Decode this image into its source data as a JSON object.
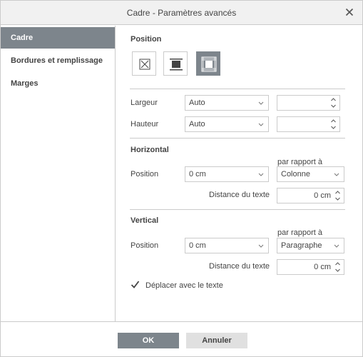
{
  "dialog": {
    "title": "Cadre - Paramètres avancés",
    "close_icon": "close-icon"
  },
  "sidebar": {
    "items": [
      {
        "label": "Cadre",
        "active": true
      },
      {
        "label": "Bordures et remplissage",
        "active": false
      },
      {
        "label": "Marges",
        "active": false
      }
    ]
  },
  "position": {
    "heading": "Position",
    "options": [
      "none-icon",
      "inline-icon",
      "frame-icon"
    ],
    "selected": 2
  },
  "size": {
    "width_label": "Largeur",
    "width_mode": "Auto",
    "width_value": "",
    "height_label": "Hauteur",
    "height_mode": "Auto",
    "height_value": ""
  },
  "horizontal": {
    "heading": "Horizontal",
    "position_label": "Position",
    "position_value": "0 cm",
    "relative_label": "par rapport à",
    "relative_value": "Colonne",
    "distance_label": "Distance du texte",
    "distance_value": "0 cm"
  },
  "vertical": {
    "heading": "Vertical",
    "position_label": "Position",
    "position_value": "0 cm",
    "relative_label": "par rapport à",
    "relative_value": "Paragraphe",
    "distance_label": "Distance du texte",
    "distance_value": "0 cm",
    "move_with_text_label": "Déplacer avec le texte",
    "move_with_text_checked": true
  },
  "footer": {
    "ok_label": "OK",
    "cancel_label": "Annuler"
  }
}
